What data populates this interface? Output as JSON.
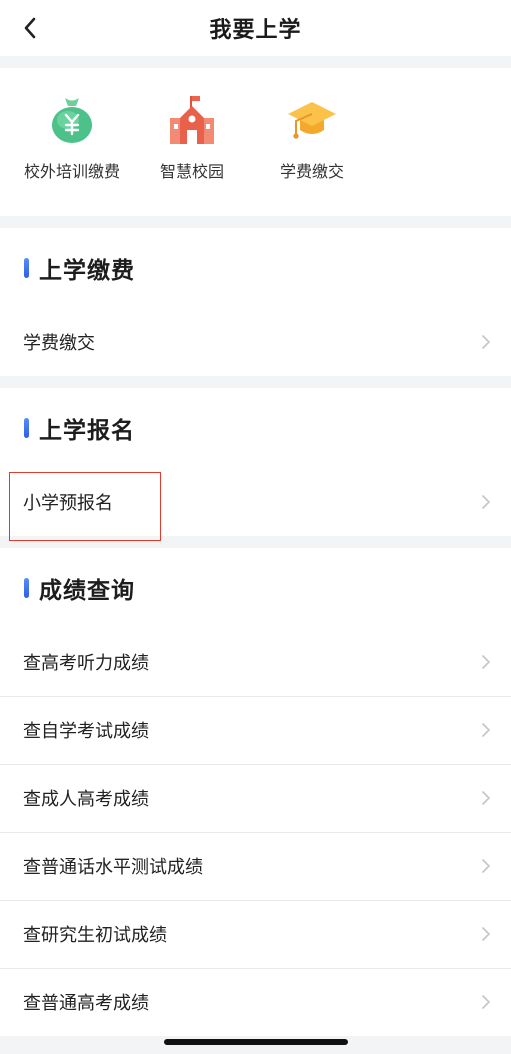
{
  "header": {
    "title": "我要上学"
  },
  "quick_links": [
    {
      "label": "校外培训缴费",
      "icon": "money-bag-icon"
    },
    {
      "label": "智慧校园",
      "icon": "school-building-icon"
    },
    {
      "label": "学费缴交",
      "icon": "graduation-cap-icon"
    }
  ],
  "sections": {
    "payment": {
      "title": "上学缴费",
      "items": [
        "学费缴交"
      ]
    },
    "enroll": {
      "title": "上学报名",
      "items": [
        "小学预报名"
      ]
    },
    "scores": {
      "title": "成绩查询",
      "items": [
        "查高考听力成绩",
        "查自学考试成绩",
        "查成人高考成绩",
        "查普通话水平测试成绩",
        "查研究生初试成绩",
        "查普通高考成绩"
      ]
    }
  },
  "colors": {
    "accent": "#3a6df0",
    "highlight_border": "#e23b2e",
    "background": "#f3f4f6"
  }
}
